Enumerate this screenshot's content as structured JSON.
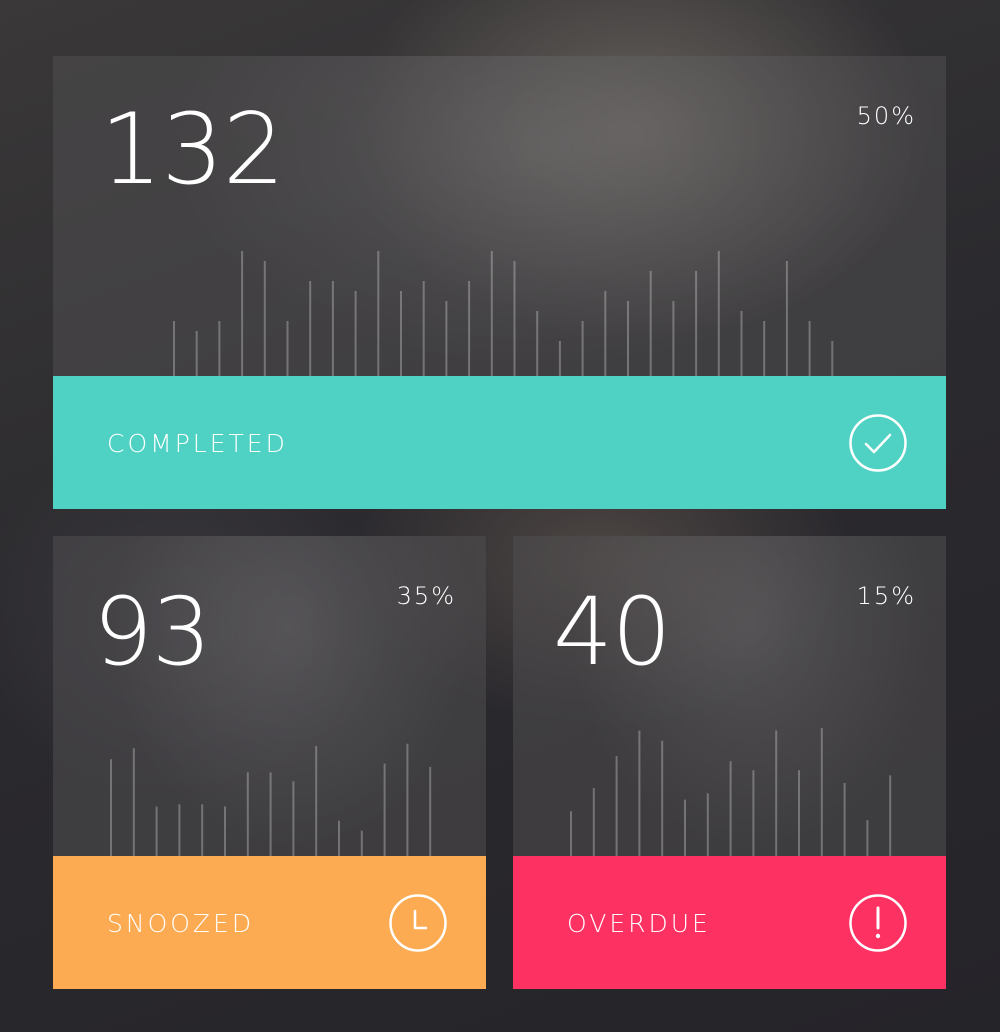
{
  "cards": [
    {
      "id": "completed",
      "count": "132",
      "percent": "50%",
      "status": "COMPLETED",
      "icon": "check-circle-icon",
      "color": "#4fd2c3",
      "bar_values": [
        0.44,
        0.36,
        0.44,
        1.0,
        0.92,
        0.44,
        0.76,
        0.76,
        0.68,
        1.0,
        0.68,
        0.76,
        0.6,
        0.76,
        1.0,
        0.92,
        0.52,
        0.28,
        0.44,
        0.68,
        0.6,
        0.84,
        0.6,
        0.84,
        1.0,
        0.52,
        0.44,
        0.92,
        0.44,
        0.28
      ]
    },
    {
      "id": "snoozed",
      "count": "93",
      "percent": "35%",
      "status": "SNOOZED",
      "icon": "clock-icon",
      "color": "#fcab52",
      "bar_values": [
        0.88,
        0.98,
        0.45,
        0.47,
        0.47,
        0.45,
        0.76,
        0.76,
        0.68,
        1.0,
        0.32,
        0.23,
        0.84,
        1.02,
        0.81
      ]
    },
    {
      "id": "overdue",
      "count": "40",
      "percent": "15%",
      "status": "OVERDUE",
      "icon": "exclamation-circle-icon",
      "color": "#fe3163",
      "bar_values": [
        0.35,
        0.53,
        0.78,
        0.98,
        0.9,
        0.44,
        0.49,
        0.74,
        0.67,
        0.98,
        0.67,
        1.0,
        0.57,
        0.28,
        0.63
      ]
    }
  ]
}
